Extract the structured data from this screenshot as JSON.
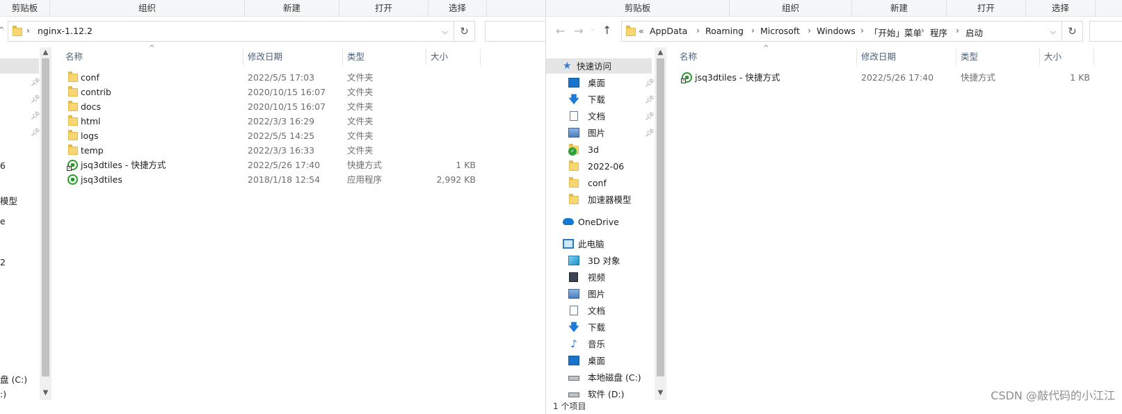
{
  "left_window": {
    "ribbon": [
      "剪贴板",
      "组织",
      "新建",
      "打开",
      "选择"
    ],
    "path": "nginx-1.12.2",
    "columns": [
      "名称",
      "修改日期",
      "类型",
      "大小"
    ],
    "nav_fragments": [
      "6",
      "模型",
      "e",
      "2",
      "盘 (C:)",
      ":)"
    ],
    "files": [
      {
        "name": "conf",
        "date": "2022/5/5 17:03",
        "type": "文件夹",
        "size": "",
        "icon": "folder-icon"
      },
      {
        "name": "contrib",
        "date": "2020/10/15 16:07",
        "type": "文件夹",
        "size": "",
        "icon": "folder-icon"
      },
      {
        "name": "docs",
        "date": "2020/10/15 16:07",
        "type": "文件夹",
        "size": "",
        "icon": "folder-icon"
      },
      {
        "name": "html",
        "date": "2022/3/3 16:29",
        "type": "文件夹",
        "size": "",
        "icon": "folder-icon"
      },
      {
        "name": "logs",
        "date": "2022/5/5 14:25",
        "type": "文件夹",
        "size": "",
        "icon": "folder-icon"
      },
      {
        "name": "temp",
        "date": "2022/3/3 16:33",
        "type": "文件夹",
        "size": "",
        "icon": "folder-icon"
      },
      {
        "name": "jsq3dtiles - 快捷方式",
        "date": "2022/5/26 17:40",
        "type": "快捷方式",
        "size": "1 KB",
        "icon": "shortcut-icon"
      },
      {
        "name": "jsq3dtiles",
        "date": "2018/1/18 12:54",
        "type": "应用程序",
        "size": "2,992 KB",
        "icon": "app-icon"
      }
    ]
  },
  "right_window": {
    "ribbon": [
      "剪贴板",
      "组织",
      "新建",
      "打开",
      "选择"
    ],
    "breadcrumb": [
      "«",
      "AppData",
      "Roaming",
      "Microsoft",
      "Windows",
      "「开始」菜单",
      "程序",
      "启动"
    ],
    "columns": [
      "名称",
      "修改日期",
      "类型",
      "大小"
    ],
    "quick_access": "快速访问",
    "nav_quick": [
      {
        "label": "桌面",
        "icon": "desktop-icon",
        "pinned": true
      },
      {
        "label": "下载",
        "icon": "download-icon",
        "pinned": true
      },
      {
        "label": "文档",
        "icon": "document-icon",
        "pinned": true
      },
      {
        "label": "图片",
        "icon": "pictures-icon",
        "pinned": true
      },
      {
        "label": "3d",
        "icon": "folder-icon",
        "pinned": false
      },
      {
        "label": "2022-06",
        "icon": "folder-icon",
        "pinned": false
      },
      {
        "label": "conf",
        "icon": "folder-icon",
        "pinned": false
      },
      {
        "label": "加速器模型",
        "icon": "folder-icon",
        "pinned": false
      }
    ],
    "onedrive": "OneDrive",
    "this_pc": "此电脑",
    "nav_pc": [
      {
        "label": "3D 对象",
        "icon": "3d-objects-icon"
      },
      {
        "label": "视频",
        "icon": "videos-icon"
      },
      {
        "label": "图片",
        "icon": "pictures-icon"
      },
      {
        "label": "文档",
        "icon": "document-icon"
      },
      {
        "label": "下载",
        "icon": "download-icon"
      },
      {
        "label": "音乐",
        "icon": "music-icon"
      },
      {
        "label": "桌面",
        "icon": "desktop-icon"
      },
      {
        "label": "本地磁盘 (C:)",
        "icon": "drive-icon"
      },
      {
        "label": "软件 (D:)",
        "icon": "drive-icon"
      }
    ],
    "files": [
      {
        "name": "jsq3dtiles - 快捷方式",
        "date": "2022/5/26 17:40",
        "type": "快捷方式",
        "size": "1 KB",
        "icon": "shortcut-icon"
      }
    ],
    "status": "1 个项目"
  },
  "watermark": "CSDN @敲代码的小江江"
}
